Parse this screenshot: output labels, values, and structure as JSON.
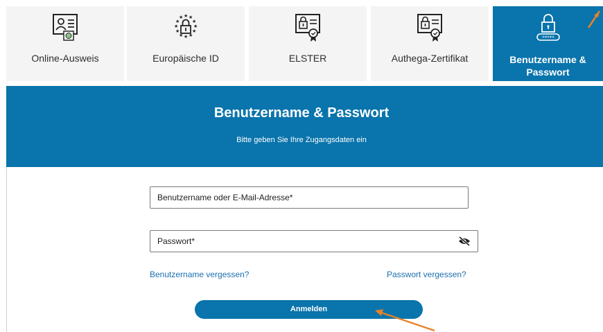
{
  "tabs": [
    {
      "label": "Online-Ausweis",
      "icon": "id-card-icon"
    },
    {
      "label": "Europäische ID",
      "icon": "eu-lock-icon"
    },
    {
      "label": "ELSTER",
      "icon": "certificate-lock-icon"
    },
    {
      "label": "Authega-Zertifikat",
      "icon": "certificate-lock-icon"
    },
    {
      "label_line1": "Benutzername &",
      "label_line2": "Passwort",
      "icon": "lock-password-icon",
      "active": true
    }
  ],
  "hero": {
    "title": "Benutzername & Passwort",
    "subtitle": "Bitte geben Sie Ihre Zugangsdaten ein"
  },
  "form": {
    "username_label": "Benutzername oder E-Mail-Adresse*",
    "password_label": "Passwort*",
    "forgot_username": "Benutzername vergessen?",
    "forgot_password": "Passwort vergessen?",
    "submit_label": "Anmelden"
  },
  "colors": {
    "primary": "#0a74ac",
    "tab_bg": "#f4f4f4",
    "link": "#1a6fb0",
    "annotation_arrow": "#e8822a"
  }
}
